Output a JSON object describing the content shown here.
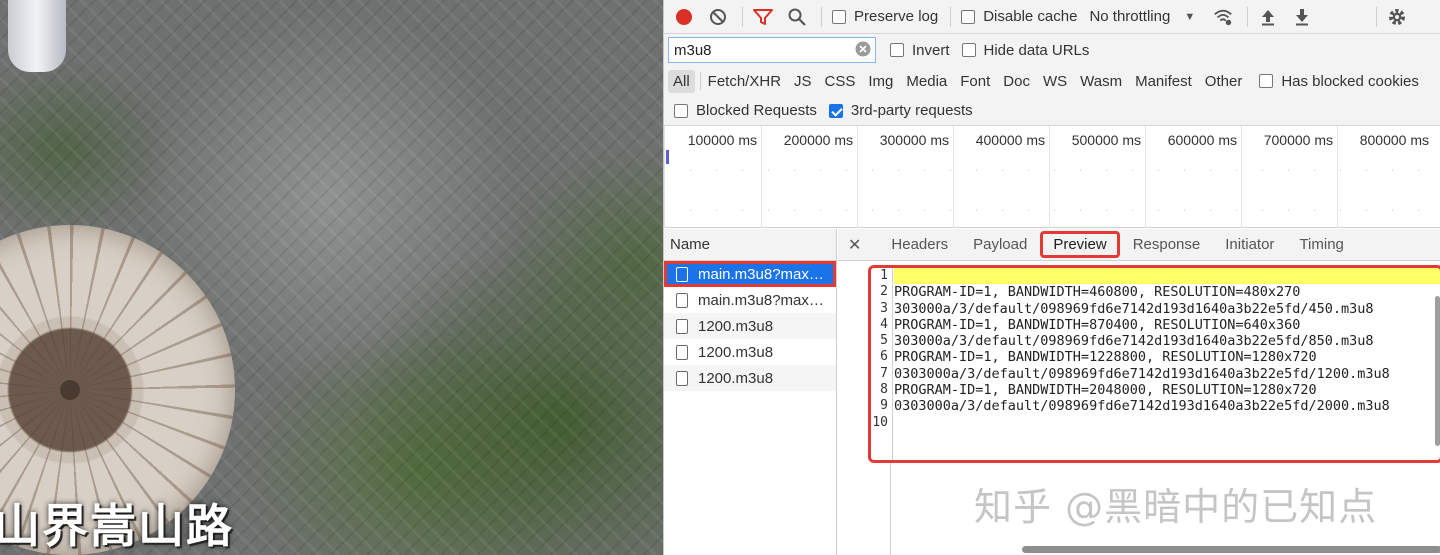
{
  "video": {
    "caption": "山界嵩山路"
  },
  "toolbar": {
    "preserve_log": "Preserve log",
    "disable_cache": "Disable cache",
    "throttling": "No throttling"
  },
  "filter": {
    "value": "m3u8",
    "invert": "Invert",
    "hide_data_urls": "Hide data URLs"
  },
  "types": {
    "items": [
      "All",
      "Fetch/XHR",
      "JS",
      "CSS",
      "Img",
      "Media",
      "Font",
      "Doc",
      "WS",
      "Wasm",
      "Manifest",
      "Other"
    ],
    "has_blocked_cookies": "Has blocked cookies"
  },
  "blocking": {
    "blocked_requests": "Blocked Requests",
    "third_party": "3rd-party requests"
  },
  "timeline": {
    "ticks": [
      "100000 ms",
      "200000 ms",
      "300000 ms",
      "400000 ms",
      "500000 ms",
      "600000 ms",
      "700000 ms",
      "800000 ms"
    ]
  },
  "requests": {
    "header": "Name",
    "items": [
      "main.m3u8?max…",
      "main.m3u8?max…",
      "1200.m3u8",
      "1200.m3u8",
      "1200.m3u8"
    ]
  },
  "detail": {
    "tabs": [
      "Headers",
      "Payload",
      "Preview",
      "Response",
      "Initiator",
      "Timing"
    ],
    "active_tab": "Preview",
    "line_numbers": [
      "1",
      "2",
      "3",
      "4",
      "5",
      "6",
      "7",
      "8",
      "9",
      "10"
    ],
    "lines": [
      "",
      "PROGRAM-ID=1, BANDWIDTH=460800, RESOLUTION=480x270",
      "303000a/3/default/098969fd6e7142d193d1640a3b22e5fd/450.m3u8",
      "PROGRAM-ID=1, BANDWIDTH=870400, RESOLUTION=640x360",
      "303000a/3/default/098969fd6e7142d193d1640a3b22e5fd/850.m3u8",
      "PROGRAM-ID=1, BANDWIDTH=1228800, RESOLUTION=1280x720",
      "0303000a/3/default/098969fd6e7142d193d1640a3b22e5fd/1200.m3u8",
      "PROGRAM-ID=1, BANDWIDTH=2048000, RESOLUTION=1280x720",
      "0303000a/3/default/098969fd6e7142d193d1640a3b22e5fd/2000.m3u8",
      ""
    ]
  },
  "watermark": "知乎 @黑暗中的已知点",
  "colors": {
    "accent_blue": "#1a73e8",
    "highlight_red": "#e53935",
    "record_red": "#d93025",
    "filter_red": "#d93025",
    "line_highlight": "#ffff66"
  },
  "icons": [
    "record-icon",
    "clear-icon",
    "filter-icon",
    "search-icon",
    "wifi-settings-icon",
    "upload-icon",
    "download-icon",
    "gear-icon",
    "clear-input-icon",
    "close-icon"
  ]
}
